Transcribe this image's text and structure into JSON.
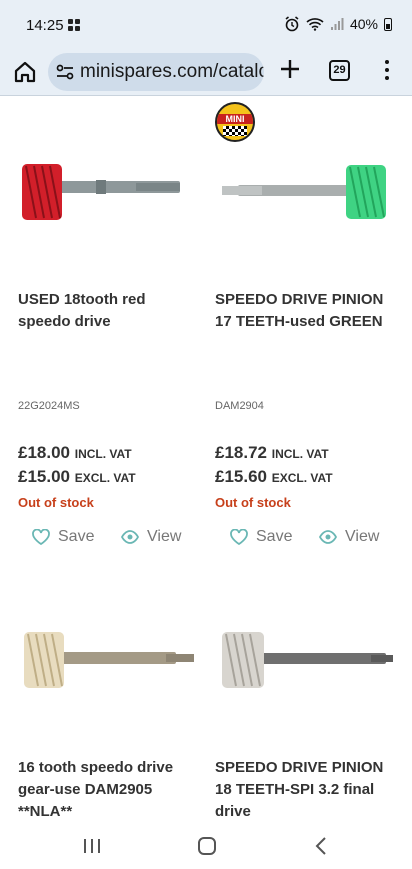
{
  "status_bar": {
    "time": "14:25",
    "battery": "40%"
  },
  "browser": {
    "url": "minispares.com/catalo",
    "tab_count": "29"
  },
  "badge": {
    "text": "MINI"
  },
  "products": [
    {
      "title": "USED 18tooth red speedo drive",
      "sku": "22G2024MS",
      "price_inc": "£18.00",
      "price_inc_label": "INCL. VAT",
      "price_exc": "£15.00",
      "price_exc_label": "EXCL. VAT",
      "stock": "Out of stock",
      "gear_color": "#d21f2a",
      "save_label": "Save",
      "view_label": "View"
    },
    {
      "title": "SPEEDO DRIVE PINION 17 TEETH-used GREEN",
      "sku": "DAM2904",
      "price_inc": "£18.72",
      "price_inc_label": "INCL. VAT",
      "price_exc": "£15.60",
      "price_exc_label": "EXCL. VAT",
      "stock": "Out of stock",
      "gear_color": "#3fd383",
      "save_label": "Save",
      "view_label": "View"
    },
    {
      "title": "16 tooth speedo drive gear-use DAM2905 **NLA**",
      "gear_color": "#e8dcbf"
    },
    {
      "title": "SPEEDO DRIVE PINION 18 TEETH-SPI 3.2 final drive",
      "gear_color": "#d8d5cf"
    }
  ],
  "colors": {
    "accent_teal": "#6ab7b4",
    "out_of_stock": "#c7401b",
    "browser_bg": "#e8eff6"
  }
}
